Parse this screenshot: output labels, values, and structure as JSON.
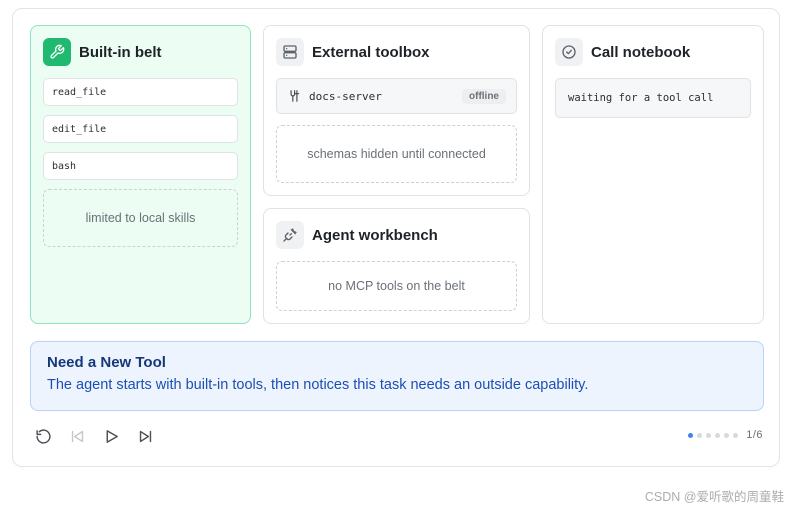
{
  "panels": {
    "belt": {
      "title": "Built-in belt",
      "tools": [
        "read_file",
        "edit_file",
        "bash"
      ],
      "note": "limited to local skills",
      "icon": "wrench-icon"
    },
    "toolbox": {
      "title": "External toolbox",
      "server_name": "docs-server",
      "server_status": "offline",
      "note": "schemas hidden until connected",
      "icon": "server-icon"
    },
    "workbench": {
      "title": "Agent workbench",
      "note": "no MCP tools on the belt",
      "icon": "plug-icon"
    },
    "notebook": {
      "title": "Call notebook",
      "status": "waiting for a tool call",
      "icon": "check-circle-icon"
    }
  },
  "banner": {
    "title": "Need a New Tool",
    "text": "The agent starts with built-in tools, then notices this task needs an outside capability."
  },
  "controls": [
    "restart-icon",
    "skip-back-icon",
    "play-icon",
    "skip-forward-icon"
  ],
  "pager": {
    "current": 1,
    "total": 6,
    "label": "1/6"
  },
  "watermark": "CSDN @爱听歌的周童鞋",
  "colors": {
    "accent_green": "#1fba6f",
    "belt_bg": "#ecfdf3",
    "banner_bg": "#edf4fe",
    "banner_title": "#15387a",
    "active_dot": "#3b82f6"
  }
}
